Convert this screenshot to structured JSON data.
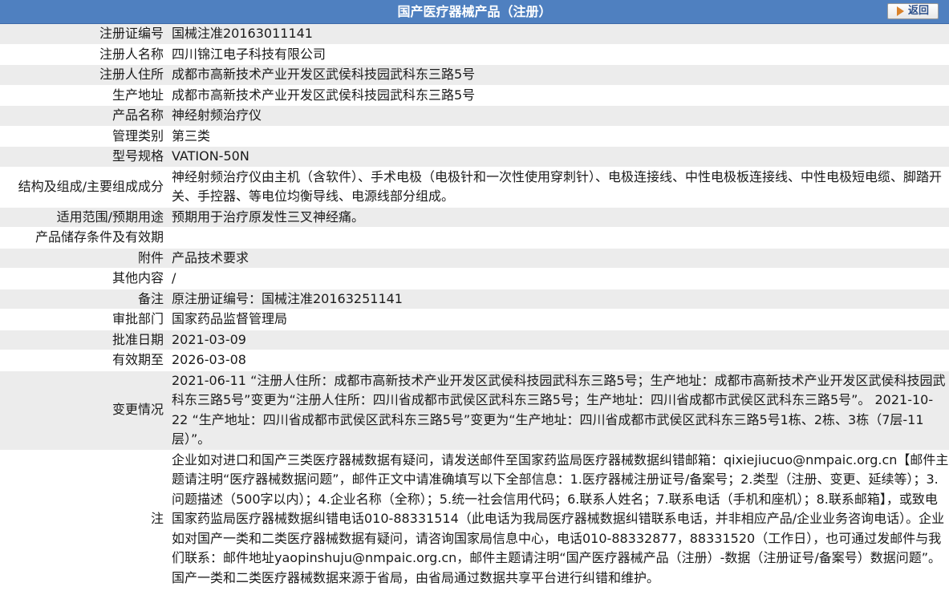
{
  "header": {
    "title": "国产医疗器械产品（注册）",
    "back_label": "返回",
    "back_icon": "back-arrow-icon",
    "accent_color": "#4f80c0"
  },
  "rows": [
    {
      "label": "注册证编号",
      "value": "国械注准20163011141"
    },
    {
      "label": "注册人名称",
      "value": "四川锦江电子科技有限公司"
    },
    {
      "label": "注册人住所",
      "value": "成都市高新技术产业开发区武侯科技园武科东三路5号"
    },
    {
      "label": "生产地址",
      "value": "成都市高新技术产业开发区武侯科技园武科东三路5号"
    },
    {
      "label": "产品名称",
      "value": "神经射频治疗仪"
    },
    {
      "label": "管理类别",
      "value": "第三类"
    },
    {
      "label": "型号规格",
      "value": "VATION-50N"
    },
    {
      "label": "结构及组成/主要组成成分",
      "value": "神经射频治疗仪由主机（含软件）、手术电极（电极针和一次性使用穿刺针）、电极连接线、中性电极板连接线、中性电极短电缆、脚踏开关、手控器、等电位均衡导线、电源线部分组成。"
    },
    {
      "label": "适用范围/预期用途",
      "value": "预期用于治疗原发性三叉神经痛。"
    },
    {
      "label": "产品储存条件及有效期",
      "value": ""
    },
    {
      "label": "附件",
      "value": "产品技术要求"
    },
    {
      "label": "其他内容",
      "value": "/"
    },
    {
      "label": "备注",
      "value": "原注册证编号：国械注准20163251141"
    },
    {
      "label": "审批部门",
      "value": "国家药品监督管理局"
    },
    {
      "label": "批准日期",
      "value": "2021-03-09"
    },
    {
      "label": "有效期至",
      "value": "2026-03-08"
    },
    {
      "label": "变更情况",
      "value": "2021-06-11 “注册人住所：成都市高新技术产业开发区武侯科技园武科东三路5号；生产地址：成都市高新技术产业开发区武侯科技园武科东三路5号”变更为“注册人住所：四川省成都市武侯区武科东三路5号；生产地址：四川省成都市武侯区武科东三路5号”。 2021-10-22 “生产地址：四川省成都市武侯区武科东三路5号”变更为“生产地址：四川省成都市武侯区武科东三路5号1栋、2栋、3栋（7层-11层）”。"
    },
    {
      "label": "注",
      "value": "企业如对进口和国产三类医疗器械数据有疑问，请发送邮件至国家药监局医疗器械数据纠错邮箱：qixiejiucuo@nmpaic.org.cn【邮件主题请注明“医疗器械数据问题”，邮件正文中请准确填写以下全部信息：1.医疗器械注册证号/备案号；2.类型（注册、变更、延续等）；3.问题描述（500字以内）；4.企业名称（全称）；5.统一社会信用代码；6.联系人姓名；7.联系电话（手机和座机）；8.联系邮箱】，或致电国家药监局医疗器械数据纠错电话010-88331514（此电话为我局医疗器械数据纠错联系电话，并非相应产品/企业业务咨询电话）。企业如对国产一类和二类医疗器械数据有疑问，请咨询国家局信息中心，电话010-88332877，88331520（工作日），也可通过发邮件与我们联系：邮件地址yaopinshuju@nmpaic.org.cn，邮件主题请注明“国产医疗器械产品（注册）-数据（注册证号/备案号）数据问题”。国产一类和二类医疗器械数据来源于省局，由省局通过数据共享平台进行纠错和维护。"
    }
  ]
}
